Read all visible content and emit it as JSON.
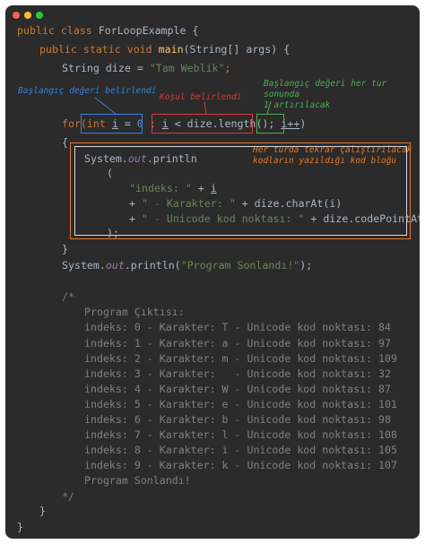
{
  "window": {
    "controls": [
      {
        "name": "close",
        "color": "#ff5f56"
      },
      {
        "name": "minimize",
        "color": "#ffbd2e"
      },
      {
        "name": "maximize",
        "color": "#27c93f"
      }
    ]
  },
  "code": {
    "class_kw": "public class",
    "class_name": "ForLoopExample",
    "open_brace": "{",
    "main_mods": "public static void",
    "main_name": "main",
    "main_params": "(String[] args) {",
    "decl_type": "String",
    "decl_var": "dize",
    "decl_eq": " = ",
    "decl_val": "\"Tam Weblik\"",
    "decl_semi": ";",
    "for_kw": "for(",
    "init_type": "int",
    "init_var": "i",
    "init_eq": " = ",
    "init_num": "0",
    "sep1": " ; ",
    "cond_var": "i",
    "cond_rest": " < dize.length();",
    "sep2": " ",
    "incr": "i++",
    "for_close": ")",
    "block_open": "{",
    "print_obj": "System.",
    "print_out": "out",
    "print_fn": ".println",
    "paren_open": "(",
    "s1_str": "\"indeks: \"",
    "s1_op": " + ",
    "s1_var": "i",
    "s2_op": "+ ",
    "s2_str": "\" - Karakter: \"",
    "s2_rest": " + dize.charAt(i)",
    "s3_op": "+ ",
    "s3_str": "\" - Unicode kod noktası: \"",
    "s3_rest": " + dize.codePointAt(i)",
    "paren_close": ");",
    "block_close": "}",
    "end_print_obj": "System.",
    "end_print_out": "out",
    "end_print_fn": ".println(",
    "end_print_str": "\"Program Sonlandı!\"",
    "end_print_close": ");",
    "comment_open": "/*",
    "output_lines": [
      "Program Çıktısı:",
      "indeks: 0 - Karakter: T - Unicode kod noktası: 84",
      "indeks: 1 - Karakter: a - Unicode kod noktası: 97",
      "indeks: 2 - Karakter: m - Unicode kod noktası: 109",
      "indeks: 3 - Karakter:   - Unicode kod noktası: 32",
      "indeks: 4 - Karakter: W - Unicode kod noktası: 87",
      "indeks: 5 - Karakter: e - Unicode kod noktası: 101",
      "indeks: 6 - Karakter: b - Unicode kod noktası: 98",
      "indeks: 7 - Karakter: l - Unicode kod noktası: 108",
      "indeks: 8 - Karakter: i - Unicode kod noktası: 105",
      "indeks: 9 - Karakter: k - Unicode kod noktası: 107",
      "Program Sonlandı!"
    ],
    "comment_close": "*/",
    "main_close": "}",
    "class_close": "}"
  },
  "annotations": {
    "init_note": "Başlangıç değeri belirlendi",
    "cond_note": "Koşul belirlendi",
    "incr_note": [
      "Başlangıç değeri her tur sonunda",
      "1 artırılacak"
    ],
    "body_note": [
      "Her turda tekrar çalıştırılacak",
      "kodların yazıldığı kod bloğu"
    ],
    "colors": {
      "init": "#3b7ddd",
      "cond": "#d63a3a",
      "incr": "#4caf50",
      "body": "#e87722"
    }
  }
}
